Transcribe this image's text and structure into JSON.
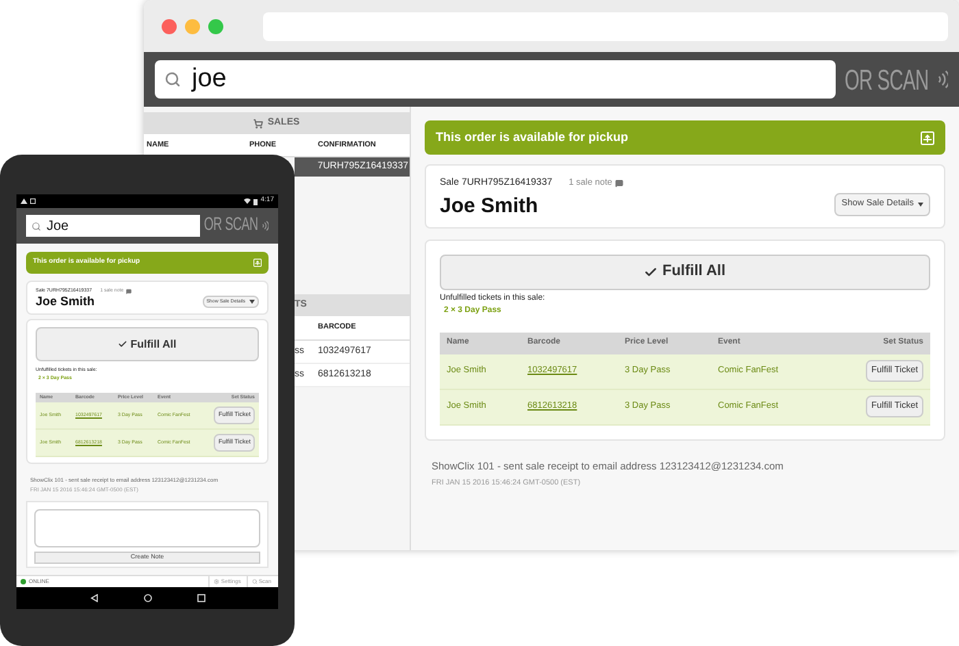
{
  "browser": {
    "search": {
      "value": "joe"
    },
    "scan_label": "OR SCAN",
    "sales": {
      "title": "SALES",
      "columns": [
        "NAME",
        "PHONE",
        "CONFIRMATION"
      ],
      "rows": [
        {
          "confirmation": "7URH795Z16419337",
          "selected": true
        }
      ]
    },
    "tickets": {
      "title": "TS",
      "columns": [
        "BARCODE"
      ],
      "rows": [
        {
          "column_1": "ss",
          "barcode": "1032497617"
        },
        {
          "column_1": "ss",
          "barcode": "6812613218"
        }
      ]
    },
    "order": {
      "banner": "This order is available for pickup",
      "sale": "Sale 7URH795Z16419337",
      "notes": "1 sale note",
      "customer": "Joe Smith",
      "details_button": "Show Sale Details",
      "fulfill_all": "Fulfill All",
      "unfulfilled_label": "Unfulfilled tickets in this sale:",
      "unfulfilled": [
        "2 × 3 Day Pass"
      ],
      "columns": [
        "Name",
        "Barcode",
        "Price Level",
        "Event",
        "Set Status"
      ],
      "rows": [
        {
          "name": "Joe Smith",
          "barcode": "1032497617",
          "price_level": "3 Day Pass",
          "event": "Comic FanFest",
          "action": "Fulfill Ticket"
        },
        {
          "name": "Joe Smith",
          "barcode": "6812613218",
          "price_level": "3 Day Pass",
          "event": "Comic FanFest",
          "action": "Fulfill Ticket"
        }
      ],
      "log": [
        {
          "message": "ShowClix 101 - sent sale receipt to email address 123123412@1231234.com",
          "time": "FRI JAN 15 2016 15:46:24 GMT-0500 (EST)"
        }
      ]
    }
  },
  "tablet": {
    "status_bar": {
      "time": "4:17"
    },
    "search": {
      "value": "Joe"
    },
    "scan_label": "OR SCAN",
    "order": {
      "banner": "This order is available for pickup",
      "sale": "Sale 7URH795Z16419337",
      "notes": "1 sale note",
      "customer": "Joe Smith",
      "details_button": "Show Sale Details",
      "fulfill_all": "Fulfill All",
      "unfulfilled_label": "Unfulfilled tickets in this sale:",
      "unfulfilled": [
        "2 × 3 Day Pass"
      ],
      "columns": [
        "Name",
        "Barcode",
        "Price Level",
        "Event",
        "Set Status"
      ],
      "rows": [
        {
          "name": "Joe Smith",
          "barcode": "1032497617",
          "price_level": "3 Day Pass",
          "event": "Comic FanFest",
          "action": "Fulfill Ticket"
        },
        {
          "name": "Joe Smith",
          "barcode": "6812613218",
          "price_level": "3 Day Pass",
          "event": "Comic FanFest",
          "action": "Fulfill Ticket"
        }
      ],
      "log": [
        {
          "message": "ShowClix 101 - sent sale receipt to email address 123123412@1231234.com",
          "time": "FRI JAN 15 2016 15:46:24 GMT-0500 (EST)"
        }
      ]
    },
    "note": {
      "button": "Create Note"
    },
    "footer": {
      "status": "ONLINE",
      "online": true,
      "buttons": [
        {
          "kind": "settings",
          "label": "Settings"
        },
        {
          "kind": "scan",
          "label": "Scan"
        }
      ]
    }
  }
}
